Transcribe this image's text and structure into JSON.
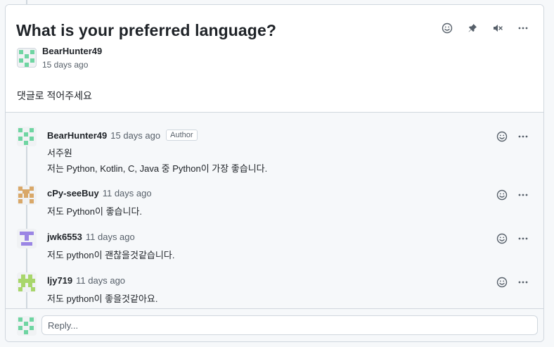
{
  "discussion": {
    "title": "What is your preferred language?",
    "author": "BearHunter49",
    "time": "15 days ago",
    "body": "댓글로 적어주세요"
  },
  "header_icons": [
    "smiley-icon",
    "pin-icon",
    "mute-icon",
    "kebab-icon"
  ],
  "colors": {
    "green_identicon": "#6fd5a2",
    "orange_identicon": "#d9a869",
    "purple_identicon": "#9a85e4",
    "lightgreen_identicon": "#a8d66b"
  },
  "comments": [
    {
      "user": "BearHunter49",
      "time": "15 days ago",
      "badge": "Author",
      "lines": [
        "서주원",
        "저는 Python, Kotlin, C, Java 중 Python이 가장 좋습니다."
      ]
    },
    {
      "user": "cPy-seeBuy",
      "time": "11 days ago",
      "badge": "",
      "lines": [
        "저도 Python이 좋습니다."
      ]
    },
    {
      "user": "jwk6553",
      "time": "11 days ago",
      "badge": "",
      "lines": [
        "저도 python이 괜찮을것같습니다."
      ]
    },
    {
      "user": "ljy719",
      "time": "11 days ago",
      "badge": "",
      "lines": [
        "저도 python이 좋을것같아요."
      ]
    }
  ],
  "reply": {
    "placeholder": "Reply..."
  }
}
